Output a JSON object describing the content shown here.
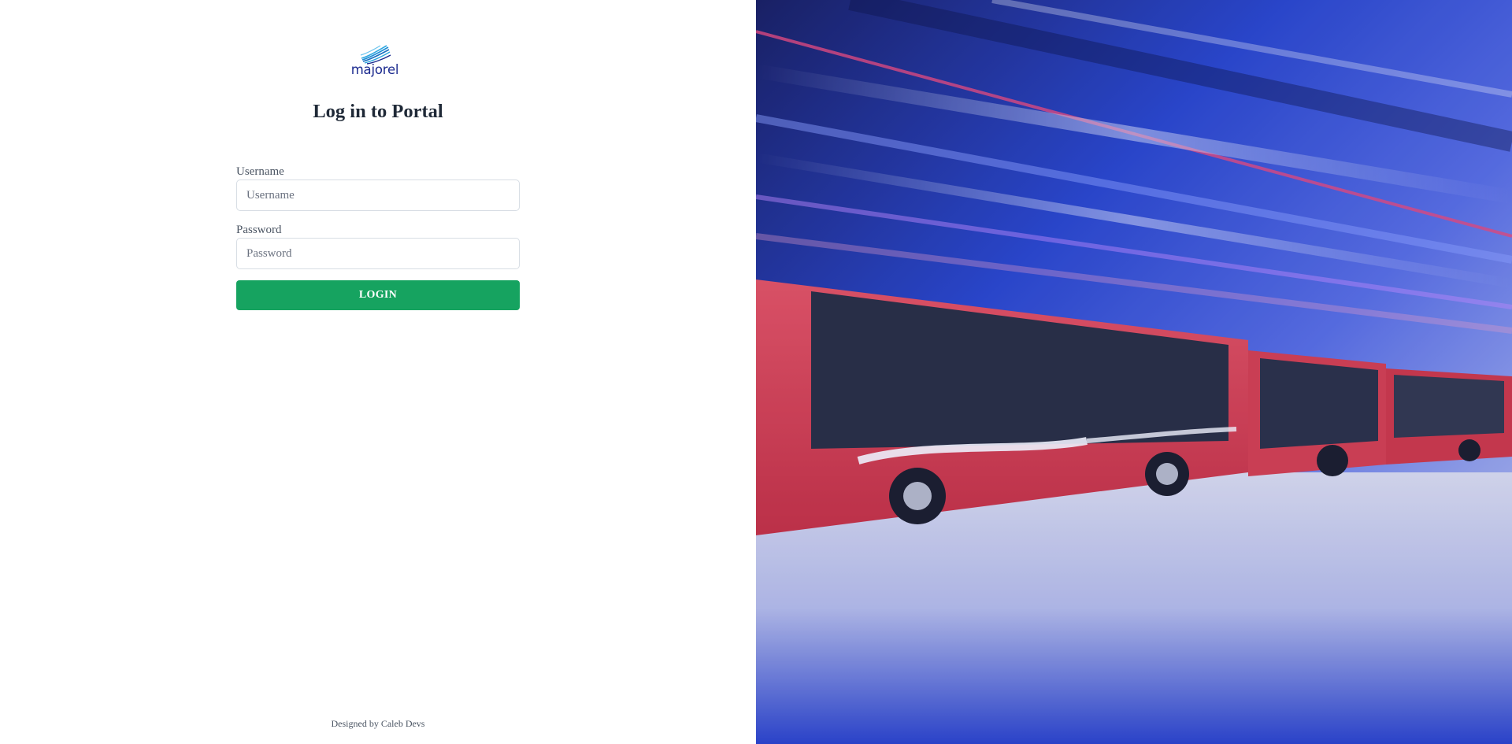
{
  "brand": {
    "logo_text": "majorel",
    "logo_color": "#1b2a8f",
    "logo_accent": "#2ea7e0"
  },
  "login": {
    "title": "Log in to Portal",
    "username_label": "Username",
    "username_placeholder": "Username",
    "username_value": "",
    "password_label": "Password",
    "password_placeholder": "Password",
    "password_value": "",
    "button_label": "LOGIN",
    "button_color": "#16a360"
  },
  "footer": {
    "credit": "Designed by Caleb Devs"
  },
  "hero": {
    "subject": "red-city-buses-in-depot-photo"
  }
}
